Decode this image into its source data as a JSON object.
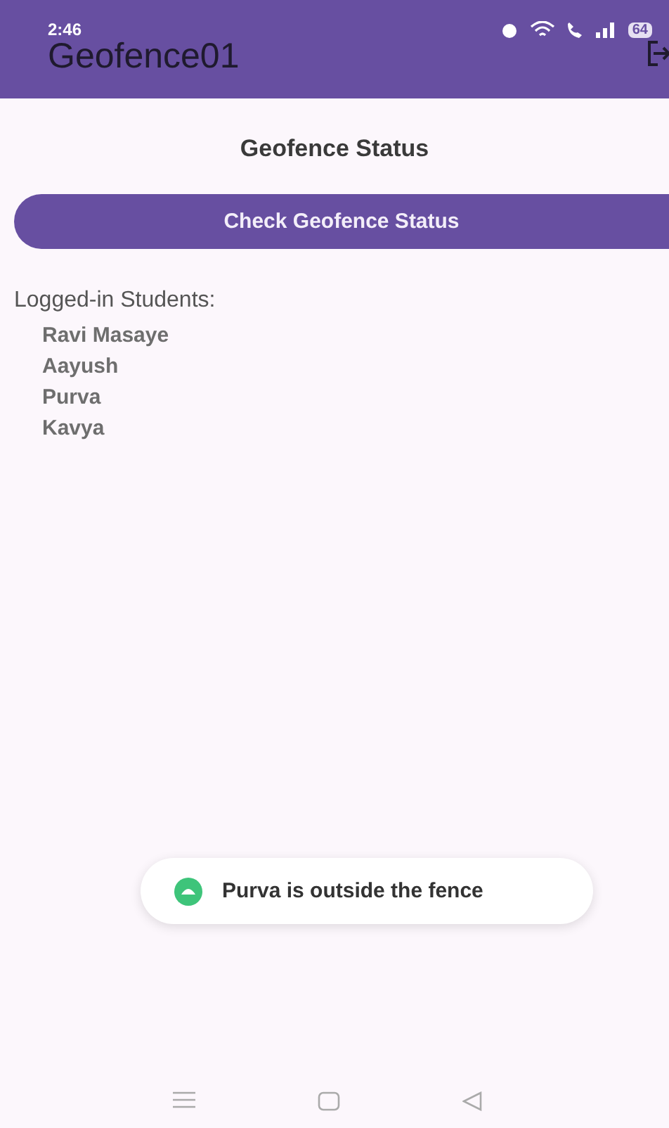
{
  "status_bar": {
    "time": "2:46",
    "battery": "64"
  },
  "app_bar": {
    "title": "Geofence01"
  },
  "heading": "Geofence Status",
  "check_button": "Check Geofence Status",
  "students": {
    "label": "Logged-in Students:",
    "names": [
      "Ravi Masaye",
      "Aayush",
      "Purva",
      "Kavya"
    ]
  },
  "toast": {
    "message": "Purva is outside the fence"
  }
}
